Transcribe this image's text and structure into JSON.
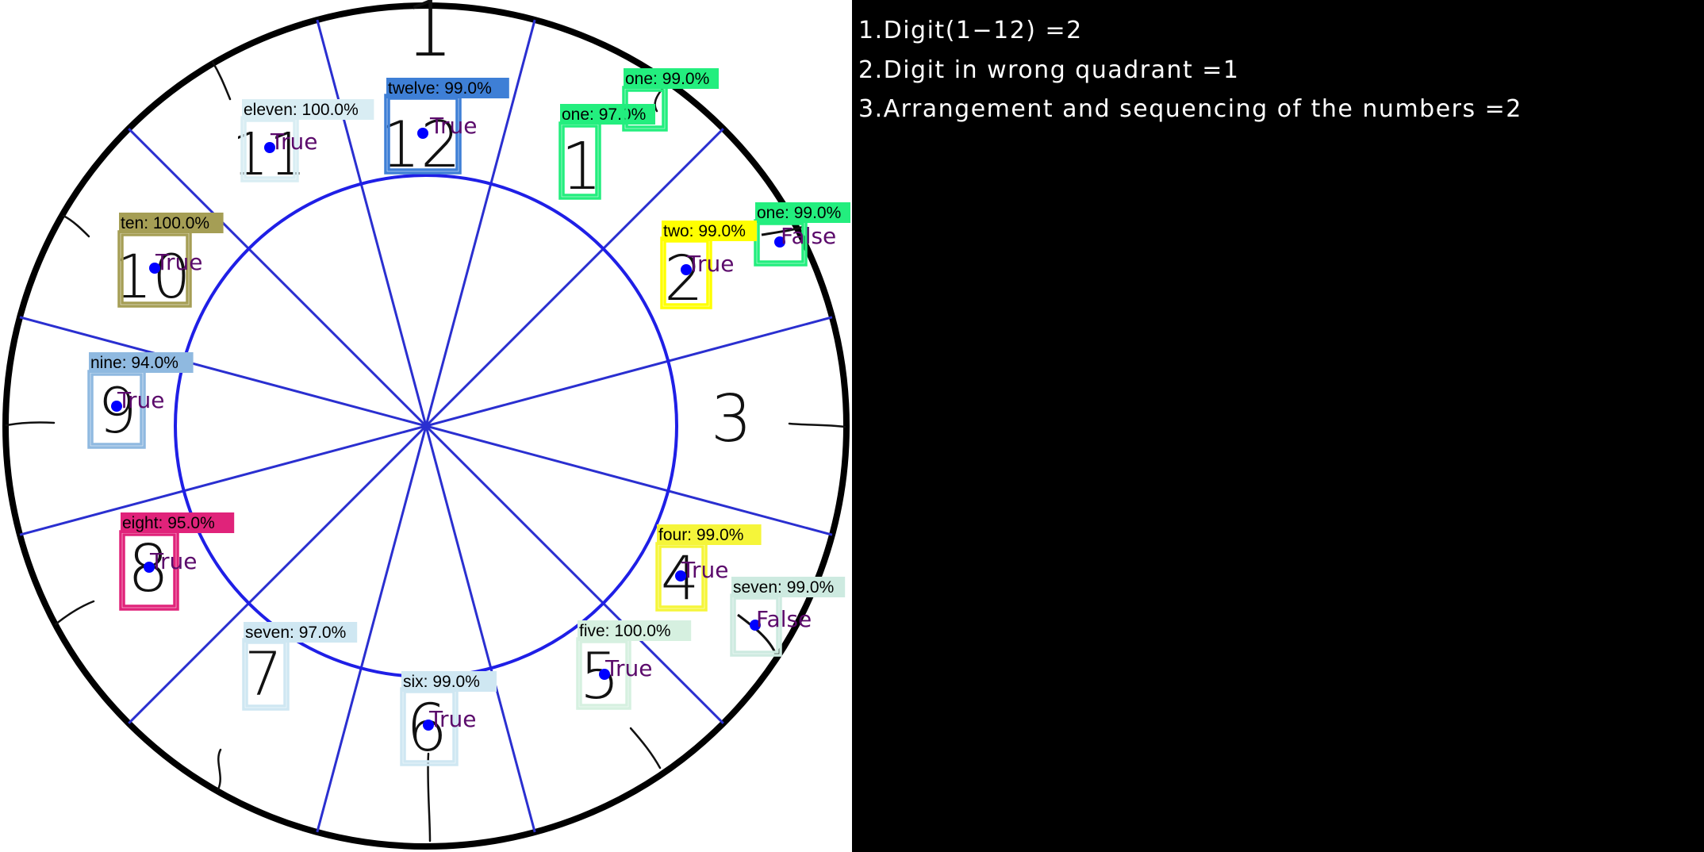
{
  "score_lines": [
    "1.Digit(1−12) =2",
    "2.Digit in wrong quadrant =1",
    "3.Arrangement and sequencing of the numbers =2"
  ],
  "overlay_colors": {
    "clock_outline": "#000000",
    "quadrant_lines": "#2a2fd0",
    "inner_circle": "#1f1fe6",
    "center_dot": "#0000ff",
    "verdict_text": "#5b0a6b",
    "label_text": "#000000"
  },
  "handwritten_numbers": [
    "12",
    "1",
    "2",
    "3",
    "4",
    "5",
    "6",
    "7",
    "8",
    "9",
    "10",
    "11"
  ],
  "detections": [
    {
      "label": "twelve: 99.0%",
      "box_color": "#3e7fd6",
      "verdict": "True"
    },
    {
      "label": "one: 97.0%",
      "box_color": "#23ee7e",
      "verdict": ""
    },
    {
      "label": "one: 99.0%",
      "box_color": "#23ee7e",
      "verdict": ""
    },
    {
      "label": "one: 99.0%",
      "box_color": "#23ee7e",
      "verdict": "False"
    },
    {
      "label": "two: 99.0%",
      "box_color": "#ffff00",
      "verdict": "True"
    },
    {
      "label": "four: 99.0%",
      "box_color": "#f5f53a",
      "verdict": "True"
    },
    {
      "label": "seven: 99.0%",
      "box_color": "#cdeae0",
      "verdict": "False"
    },
    {
      "label": "five: 100.0%",
      "box_color": "#d6f0e0",
      "verdict": "True"
    },
    {
      "label": "six: 99.0%",
      "box_color": "#cfe7f2",
      "verdict": "True"
    },
    {
      "label": "seven: 97.0%",
      "box_color": "#cfe7f2",
      "verdict": ""
    },
    {
      "label": "eight: 95.0%",
      "box_color": "#e0237a",
      "verdict": "True"
    },
    {
      "label": "nine: 94.0%",
      "box_color": "#8fb9e0",
      "verdict": "True"
    },
    {
      "label": "ten: 100.0%",
      "box_color": "#a59e55",
      "verdict": "True"
    },
    {
      "label": "eleven: 100.0%",
      "box_color": "#d9edf3",
      "verdict": "True"
    }
  ]
}
